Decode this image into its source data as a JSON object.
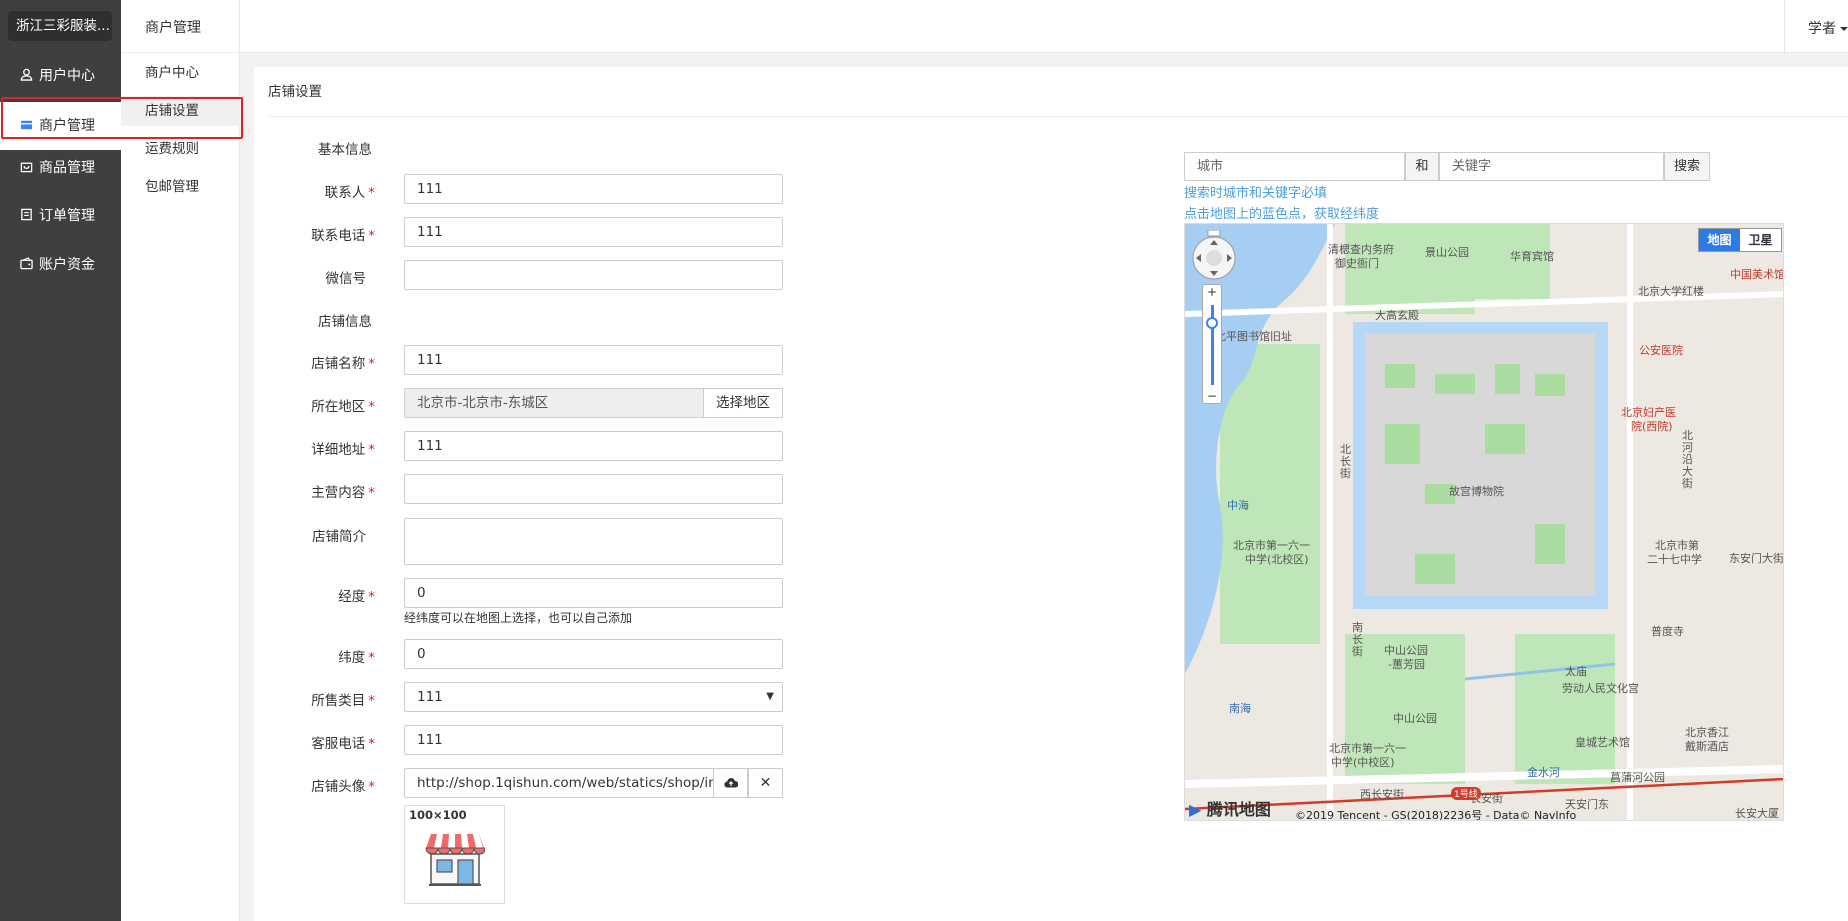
{
  "sidebar": {
    "brand": "浙江三彩服装...",
    "items": [
      {
        "label": "用户中心",
        "icon": "user-icon"
      },
      {
        "label": "商户管理",
        "icon": "store-icon"
      },
      {
        "label": "商品管理",
        "icon": "bag-icon"
      },
      {
        "label": "订单管理",
        "icon": "order-icon"
      },
      {
        "label": "账户资金",
        "icon": "wallet-icon"
      }
    ]
  },
  "subnav": {
    "title": "商户管理",
    "items": [
      "商户中心",
      "店铺设置",
      "运费规则",
      "包邮管理"
    ]
  },
  "header": {
    "user": "学者"
  },
  "panel": {
    "title": "店铺设置"
  },
  "form": {
    "section_basic": "基本信息",
    "section_shop": "店铺信息",
    "contact_label": "联系人",
    "contact_value": "111",
    "phone_label": "联系电话",
    "phone_value": "111",
    "wechat_label": "微信号",
    "wechat_value": "",
    "shopname_label": "店铺名称",
    "shopname_value": "111",
    "region_label": "所在地区",
    "region_value": "北京市-北京市-东城区",
    "region_button": "选择地区",
    "address_label": "详细地址",
    "address_value": "111",
    "business_label": "主营内容",
    "business_value": "",
    "intro_label": "店铺简介",
    "intro_value": "",
    "longitude_label": "经度",
    "longitude_value": "0",
    "longitude_help": "经纬度可以在地图上选择，也可以自己添加",
    "latitude_label": "纬度",
    "latitude_value": "0",
    "category_label": "所售类目",
    "category_value": "111",
    "service_phone_label": "客服电话",
    "service_phone_value": "111",
    "avatar_label": "店铺头像",
    "avatar_value": "http://shop.1qishun.com/web/statics/shop/img/",
    "avatar_size": "100×100",
    "required_mark": "*"
  },
  "map": {
    "city_placeholder": "城市",
    "and_label": "和",
    "keyword_placeholder": "关键字",
    "search_button": "搜索",
    "hint1": "搜索时城市和关键字必填",
    "hint2": "点击地图上的蓝色点，获取经纬度",
    "type_map": "地图",
    "type_satellite": "卫星",
    "logo": "腾讯地图",
    "copyright": "©2019 Tencent - GS(2018)2236号 - Data© NavInfo",
    "labels": {
      "l1": "清楒查内务府",
      "l2": "御史衙门",
      "l3": "景山公园",
      "l4": "华育宾馆",
      "l5": "北京大学红楼",
      "l6": "大高玄殿",
      "l7": "北平图书馆旧址",
      "l8": "公安医院",
      "l9": "北京妇产医",
      "l10": "院(西院)",
      "l11": "故宫博物院",
      "l12": "中海",
      "l13": "北京市第一六一",
      "l14": "中学(北校区)",
      "l15": "北京市第",
      "l16": "二十七中学",
      "l17": "东安门大街",
      "l18": "普度寺",
      "l19": "中山公园",
      "l20": "-蕙芳园",
      "l21": "太庙",
      "l22": "劳动人民文化宫",
      "l23": "中山公园",
      "l24": "南海",
      "l25": "北京市第一六一",
      "l26": "中学(中校区)",
      "l27": "皇城艺术馆",
      "l28": "金水河",
      "l29": "菖蒲河公园",
      "l30": "天安门东",
      "l31": "长安街",
      "l32": "西长安街",
      "l33": "中国美术馆",
      "l34": "北京香江",
      "l35": "戴斯酒店",
      "l36": "长安大厦",
      "l37": "北长街",
      "l38": "南长街",
      "l39": "1号线",
      "l40": "北河沿大街"
    }
  }
}
